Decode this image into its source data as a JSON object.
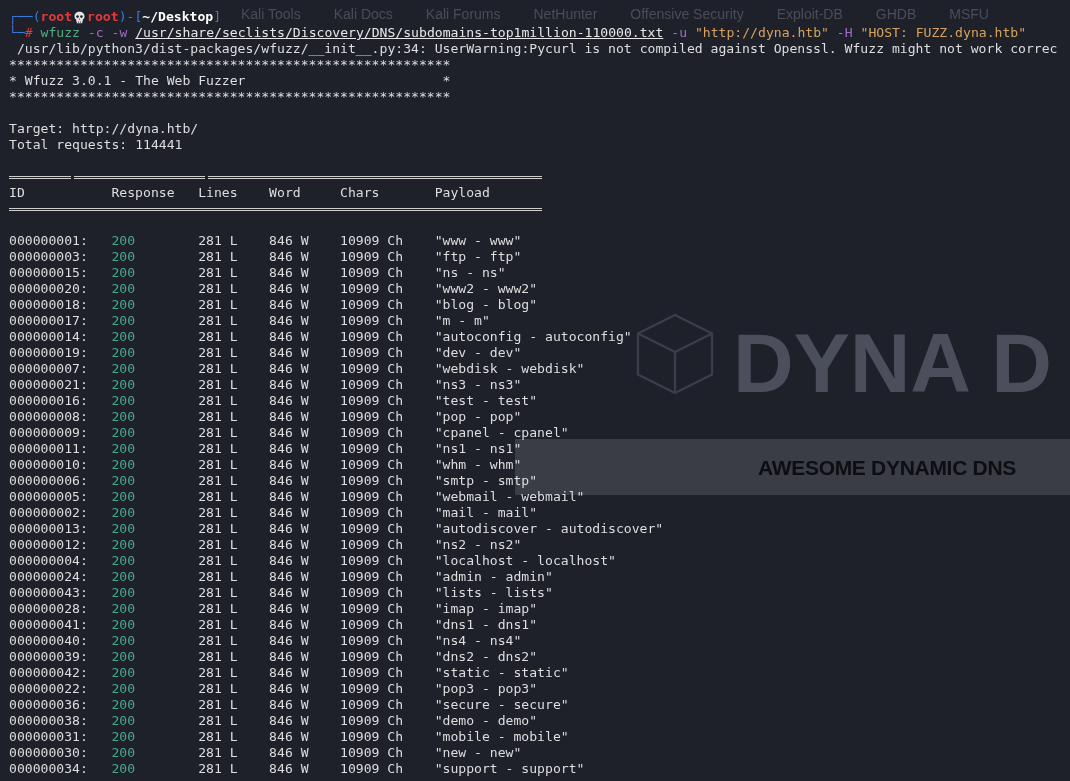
{
  "background_page": {
    "bookmarks": [
      "Kali Tools",
      "Kali Docs",
      "Kali Forums",
      "NetHunter",
      "Offensive Security",
      "Exploit-DB",
      "GHDB",
      "MSFU"
    ],
    "logo_text": "DYNA D",
    "tagline": "AWESOME DYNAMIC DNS"
  },
  "prompt": [
    {
      "kind": "frame",
      "text": "┌──("
    },
    {
      "kind": "user",
      "text": "root"
    },
    {
      "kind": "skull"
    },
    {
      "kind": "host",
      "text": "root"
    },
    {
      "kind": "frame",
      "text": ")-["
    },
    {
      "kind": "path",
      "text": "~/Desktop"
    },
    {
      "kind": "frame",
      "text": "]"
    }
  ],
  "command_line": {
    "prefix": [
      {
        "kind": "frame",
        "text": "└─"
      },
      {
        "kind": "symbol",
        "text": "#"
      }
    ],
    "tokens": [
      {
        "kind": "command",
        "text": "wfuzz"
      },
      {
        "kind": "flag",
        "text": "-c"
      },
      {
        "kind": "flag",
        "text": "-w"
      },
      {
        "kind": "file",
        "text": "/usr/share/seclists/Discovery/DNS/subdomains-top1million-110000.txt"
      },
      {
        "kind": "flag",
        "text": "-u"
      },
      {
        "kind": "string",
        "text": "\"http://dyna.htb\""
      },
      {
        "kind": "flag",
        "text": "-H"
      },
      {
        "kind": "string",
        "text": "\"HOST: FUZZ.dyna.htb\""
      }
    ]
  },
  "output": {
    "warning": "/usr/lib/python3/dist-packages/wfuzz/__init__.py:34: UserWarning:Pycurl is not compiled against Openssl. Wfuzz might not work correc",
    "banner": [
      "********************************************************",
      "* Wfuzz 3.0.1 - The Web Fuzzer                         *",
      "********************************************************"
    ],
    "target": "Target: http://dyna.htb/",
    "total_requests": "Total requests: 114441"
  },
  "table": {
    "columns": [
      "ID",
      "Response",
      "Lines",
      "Word",
      "Chars",
      "Payload"
    ],
    "rows": [
      {
        "id": "000000001:",
        "response": "200",
        "lines": "281 L",
        "word": "846 W",
        "chars": "10909 Ch",
        "payload": "\"www - www\""
      },
      {
        "id": "000000003:",
        "response": "200",
        "lines": "281 L",
        "word": "846 W",
        "chars": "10909 Ch",
        "payload": "\"ftp - ftp\""
      },
      {
        "id": "000000015:",
        "response": "200",
        "lines": "281 L",
        "word": "846 W",
        "chars": "10909 Ch",
        "payload": "\"ns - ns\""
      },
      {
        "id": "000000020:",
        "response": "200",
        "lines": "281 L",
        "word": "846 W",
        "chars": "10909 Ch",
        "payload": "\"www2 - www2\""
      },
      {
        "id": "000000018:",
        "response": "200",
        "lines": "281 L",
        "word": "846 W",
        "chars": "10909 Ch",
        "payload": "\"blog - blog\""
      },
      {
        "id": "000000017:",
        "response": "200",
        "lines": "281 L",
        "word": "846 W",
        "chars": "10909 Ch",
        "payload": "\"m - m\""
      },
      {
        "id": "000000014:",
        "response": "200",
        "lines": "281 L",
        "word": "846 W",
        "chars": "10909 Ch",
        "payload": "\"autoconfig - autoconfig\""
      },
      {
        "id": "000000019:",
        "response": "200",
        "lines": "281 L",
        "word": "846 W",
        "chars": "10909 Ch",
        "payload": "\"dev - dev\""
      },
      {
        "id": "000000007:",
        "response": "200",
        "lines": "281 L",
        "word": "846 W",
        "chars": "10909 Ch",
        "payload": "\"webdisk - webdisk\""
      },
      {
        "id": "000000021:",
        "response": "200",
        "lines": "281 L",
        "word": "846 W",
        "chars": "10909 Ch",
        "payload": "\"ns3 - ns3\""
      },
      {
        "id": "000000016:",
        "response": "200",
        "lines": "281 L",
        "word": "846 W",
        "chars": "10909 Ch",
        "payload": "\"test - test\""
      },
      {
        "id": "000000008:",
        "response": "200",
        "lines": "281 L",
        "word": "846 W",
        "chars": "10909 Ch",
        "payload": "\"pop - pop\""
      },
      {
        "id": "000000009:",
        "response": "200",
        "lines": "281 L",
        "word": "846 W",
        "chars": "10909 Ch",
        "payload": "\"cpanel - cpanel\""
      },
      {
        "id": "000000011:",
        "response": "200",
        "lines": "281 L",
        "word": "846 W",
        "chars": "10909 Ch",
        "payload": "\"ns1 - ns1\""
      },
      {
        "id": "000000010:",
        "response": "200",
        "lines": "281 L",
        "word": "846 W",
        "chars": "10909 Ch",
        "payload": "\"whm - whm\""
      },
      {
        "id": "000000006:",
        "response": "200",
        "lines": "281 L",
        "word": "846 W",
        "chars": "10909 Ch",
        "payload": "\"smtp - smtp\""
      },
      {
        "id": "000000005:",
        "response": "200",
        "lines": "281 L",
        "word": "846 W",
        "chars": "10909 Ch",
        "payload": "\"webmail - webmail\""
      },
      {
        "id": "000000002:",
        "response": "200",
        "lines": "281 L",
        "word": "846 W",
        "chars": "10909 Ch",
        "payload": "\"mail - mail\""
      },
      {
        "id": "000000013:",
        "response": "200",
        "lines": "281 L",
        "word": "846 W",
        "chars": "10909 Ch",
        "payload": "\"autodiscover - autodiscover\""
      },
      {
        "id": "000000012:",
        "response": "200",
        "lines": "281 L",
        "word": "846 W",
        "chars": "10909 Ch",
        "payload": "\"ns2 - ns2\""
      },
      {
        "id": "000000004:",
        "response": "200",
        "lines": "281 L",
        "word": "846 W",
        "chars": "10909 Ch",
        "payload": "\"localhost - localhost\""
      },
      {
        "id": "000000024:",
        "response": "200",
        "lines": "281 L",
        "word": "846 W",
        "chars": "10909 Ch",
        "payload": "\"admin - admin\""
      },
      {
        "id": "000000043:",
        "response": "200",
        "lines": "281 L",
        "word": "846 W",
        "chars": "10909 Ch",
        "payload": "\"lists - lists\""
      },
      {
        "id": "000000028:",
        "response": "200",
        "lines": "281 L",
        "word": "846 W",
        "chars": "10909 Ch",
        "payload": "\"imap - imap\""
      },
      {
        "id": "000000041:",
        "response": "200",
        "lines": "281 L",
        "word": "846 W",
        "chars": "10909 Ch",
        "payload": "\"dns1 - dns1\""
      },
      {
        "id": "000000040:",
        "response": "200",
        "lines": "281 L",
        "word": "846 W",
        "chars": "10909 Ch",
        "payload": "\"ns4 - ns4\""
      },
      {
        "id": "000000039:",
        "response": "200",
        "lines": "281 L",
        "word": "846 W",
        "chars": "10909 Ch",
        "payload": "\"dns2 - dns2\""
      },
      {
        "id": "000000042:",
        "response": "200",
        "lines": "281 L",
        "word": "846 W",
        "chars": "10909 Ch",
        "payload": "\"static - static\""
      },
      {
        "id": "000000022:",
        "response": "200",
        "lines": "281 L",
        "word": "846 W",
        "chars": "10909 Ch",
        "payload": "\"pop3 - pop3\""
      },
      {
        "id": "000000036:",
        "response": "200",
        "lines": "281 L",
        "word": "846 W",
        "chars": "10909 Ch",
        "payload": "\"secure - secure\""
      },
      {
        "id": "000000038:",
        "response": "200",
        "lines": "281 L",
        "word": "846 W",
        "chars": "10909 Ch",
        "payload": "\"demo - demo\""
      },
      {
        "id": "000000031:",
        "response": "200",
        "lines": "281 L",
        "word": "846 W",
        "chars": "10909 Ch",
        "payload": "\"mobile - mobile\""
      },
      {
        "id": "000000030:",
        "response": "200",
        "lines": "281 L",
        "word": "846 W",
        "chars": "10909 Ch",
        "payload": "\"new - new\""
      },
      {
        "id": "000000034:",
        "response": "200",
        "lines": "281 L",
        "word": "846 W",
        "chars": "10909 Ch",
        "payload": "\"support - support\""
      }
    ]
  }
}
